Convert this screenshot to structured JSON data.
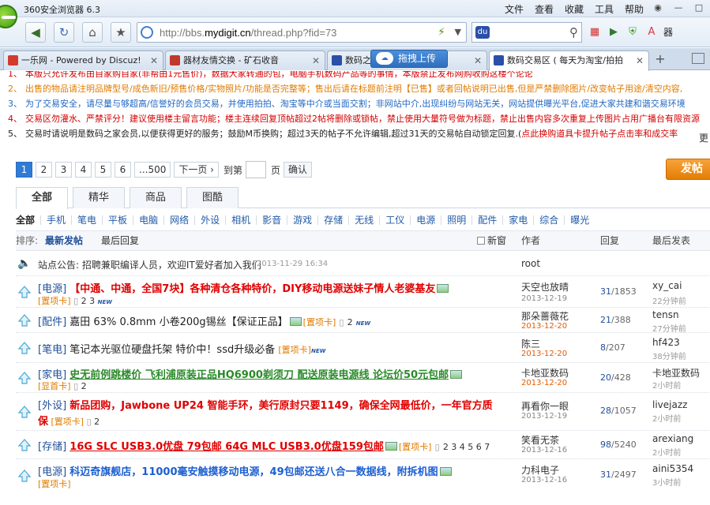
{
  "browser": {
    "title": "360安全浏览器 6.3",
    "menu": [
      "文件",
      "查看",
      "收藏",
      "工具",
      "帮助"
    ],
    "url_prefix": "http://bbs.",
    "url_domain": "mydigit.cn",
    "url_suffix": "/thread.php?fid=73",
    "toolbar_text": "器",
    "tabs": [
      {
        "label": "一乐网 - Powered by Discuz!",
        "icon_color": "#d23b2b"
      },
      {
        "label": "器材友情交换 - 矿石收音",
        "icon_color": "#c0392b"
      },
      {
        "label": "数码之",
        "icon_color": "#2a4fa8"
      },
      {
        "label": "数码交易区 ( 每天为淘宝/拍拍",
        "icon_color": "#2a4fa8"
      }
    ],
    "upload_label": "拖拽上传"
  },
  "rules": [
    {
      "n": "1、",
      "text": "本版只允许发布由自家购自家(非帮由1元售价)，数据大家转通的包，电脑手机数码产品等的事情，本版禁止发布网购收购这楼个论论",
      "color": "red"
    },
    {
      "n": "2、",
      "text": "出售的物品请注明品牌型号/成色新旧/预售价格/实物照片/功能是否完整等；售出后请在标题前注明【已售】或者回帖说明已出售,但是严禁删除图片/改变帖子用途/清空内容,",
      "color": "orange"
    },
    {
      "n": "3、",
      "text": "为了交易安全，请尽量与够超高/信誉好的会员交易，并使用拍拍、淘宝等中介或当面交割；非网站中介,出现纠纷与网站无关，网站提供曝光平台,促进大家共建和谐交易环境",
      "color": "blue"
    },
    {
      "n": "4、",
      "text": "交易区勿灌水、严禁评分！建议使用楼主留言功能；楼主连续回复顶帖超过2帖将删除或锁帖，禁止使用大量符号做为标题，禁止出售内容多次重复上传图片占用广播台有限资源",
      "color": "red"
    },
    {
      "n": "5、",
      "text": "交易时请说明是数码之家会员,以便获得更好的服务；鼓励M币换购；超过3天的帖子不允许编辑,超过31天的交易帖自动锁定回复.(",
      "link": "点此换购道具卡提升帖子点击率和成交率",
      "color": "dark"
    }
  ],
  "more_label": "更",
  "pager": {
    "pages": [
      "1",
      "2",
      "3",
      "4",
      "5",
      "6",
      "...500"
    ],
    "next": "下一页 ›",
    "goto_label": "到第",
    "page_label": "页",
    "confirm": "确认"
  },
  "post_button": "发帖",
  "main_tabs": [
    "全部",
    "精华",
    "商品",
    "图酷"
  ],
  "categories": [
    "全部",
    "手机",
    "笔电",
    "平板",
    "电脑",
    "网络",
    "外设",
    "相机",
    "影音",
    "游戏",
    "存储",
    "无线",
    "工仪",
    "电源",
    "照明",
    "配件",
    "家电",
    "综合",
    "曝光"
  ],
  "sort": {
    "label": "排序:",
    "newest": "最新发帖",
    "last_reply": "最后回复",
    "new_window": "新窗",
    "author": "作者",
    "replies": "回复",
    "last_post": "最后发表"
  },
  "announcement": {
    "text": "站点公告: 招聘兼职编译人员，欢迎IT爱好者加入我们",
    "date": "2013-11-29 16:34",
    "author": "root"
  },
  "threads": [
    {
      "cat": "[电源]",
      "title": "【中通、中通，全国7块】各种清仓各种特价，DIY移动电源送妹子情人老婆基友",
      "style": "red",
      "has_img": true,
      "line2": "[置项卡]",
      "pages": "2 3",
      "new": "NEW",
      "author": "天空也放晴",
      "date": "2013-12-19",
      "date_new": false,
      "replies": "31",
      "views": "1853",
      "last_user": "xy_cai",
      "last_time": "22分钟前"
    },
    {
      "cat": "[配件]",
      "title": "嘉田 63% 0.8mm 小卷200g锡丝【保证正品】",
      "style": "plain",
      "inline_extra": "[置项卡]",
      "pages": "2",
      "new": "NEW",
      "has_img": true,
      "author": "那朵蔷薇花",
      "date": "2013-12-20",
      "date_new": true,
      "replies": "21",
      "views": "388",
      "last_user": "tensn",
      "last_time": "27分钟前"
    },
    {
      "cat": "[笔电]",
      "title": "笔记本光驱位硬盘托架 特价中！ssd升级必备",
      "style": "plain",
      "inline_extra": "[置项卡]",
      "new": "NEW",
      "author": "陈三",
      "date": "2013-12-20",
      "date_new": true,
      "replies": "8",
      "views": "207",
      "last_user": "hf423",
      "last_time": "38分钟前"
    },
    {
      "cat": "[家电]",
      "title": "史无前例跳楼价 飞利浦原装正品HQ6900剃须刀 配送原装电源线 论坛价50元包邮",
      "style": "green",
      "has_img": true,
      "line2": "[显首卡]",
      "pages": "2",
      "author": "卡地亚数码",
      "date": "2013-12-20",
      "date_new": true,
      "replies": "20",
      "views": "428",
      "last_user": "卡地亚数码",
      "last_time": "2小时前"
    },
    {
      "cat": "[外设]",
      "title": "新品团购，Jawbone UP24 智能手环，美行原封只要1149，确保全网最低价，一年官方质",
      "title2": "保",
      "style": "red",
      "line2": "[置项卡]",
      "pages": "2",
      "author": "再看你一眼",
      "date": "2013-12-19",
      "date_new": false,
      "replies": "28",
      "views": "1057",
      "last_user": "livejazz",
      "last_time": "2小时前"
    },
    {
      "cat": "[存储]",
      "title": "16G SLC USB3.0优盘 79包邮 64G MLC USB3.0优盘159包邮",
      "style": "red-u",
      "has_img": true,
      "inline_extra": "[置项卡]",
      "pages": "2 3 4 5 6 7",
      "author": "笑看无茶",
      "date": "2013-12-16",
      "date_new": false,
      "replies": "98",
      "views": "5240",
      "last_user": "arexiang",
      "last_time": "2小时前"
    },
    {
      "cat": "[电源]",
      "title": "科迈奇旗舰店，11000毫安触摸移动电源，49包邮还送八合一数据线，附拆机图",
      "style": "blue",
      "has_img": true,
      "line2": "[置项卡]",
      "author": "力科电子",
      "date": "2013-12-16",
      "date_new": false,
      "replies": "31",
      "views": "2497",
      "last_user": "aini5354",
      "last_time": "3小时前"
    }
  ]
}
